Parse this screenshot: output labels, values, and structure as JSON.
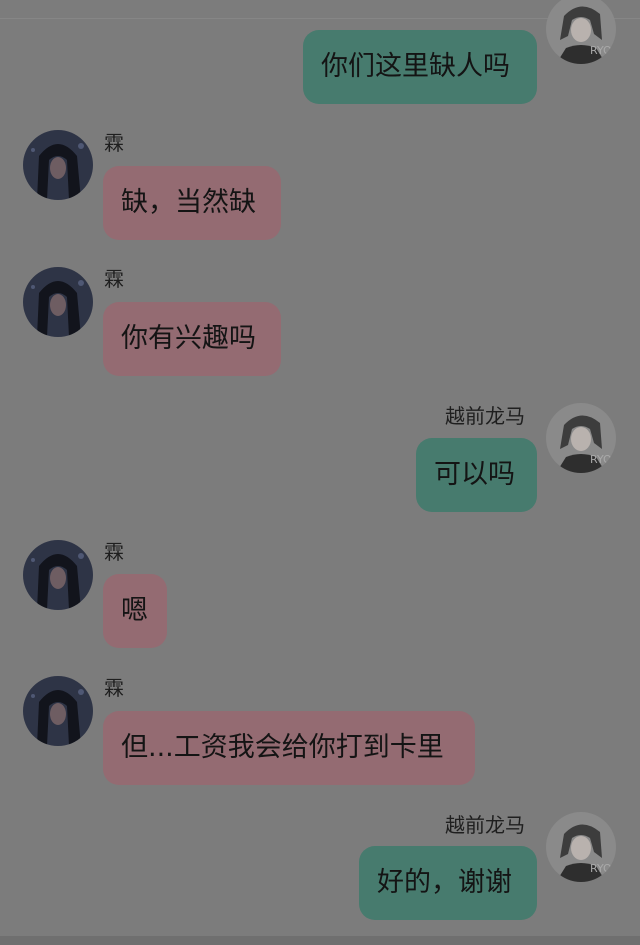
{
  "theme": {
    "background": "#7c7c7c",
    "left_bubble_color": "#946b72",
    "right_bubble_color": "#477b6e"
  },
  "contacts": {
    "other": {
      "name": "霖",
      "avatar_icon": "dark-hair-anime-avatar-icon"
    },
    "me": {
      "name": "越前龙马",
      "avatar_icon": "ryo-anime-avatar-icon"
    }
  },
  "messages": [
    {
      "side": "right",
      "text": "你们这里缺人吗"
    },
    {
      "side": "left",
      "sender": "霖",
      "text": "缺，当然缺"
    },
    {
      "side": "left",
      "sender": "霖",
      "text": "你有兴趣吗"
    },
    {
      "side": "right",
      "sender": "越前龙马",
      "text": "可以吗"
    },
    {
      "side": "left",
      "sender": "霖",
      "text": "嗯"
    },
    {
      "side": "left",
      "sender": "霖",
      "text": "但...工资我会给你打到卡里"
    },
    {
      "side": "right",
      "sender": "越前龙马",
      "text": "好的，谢谢"
    }
  ]
}
